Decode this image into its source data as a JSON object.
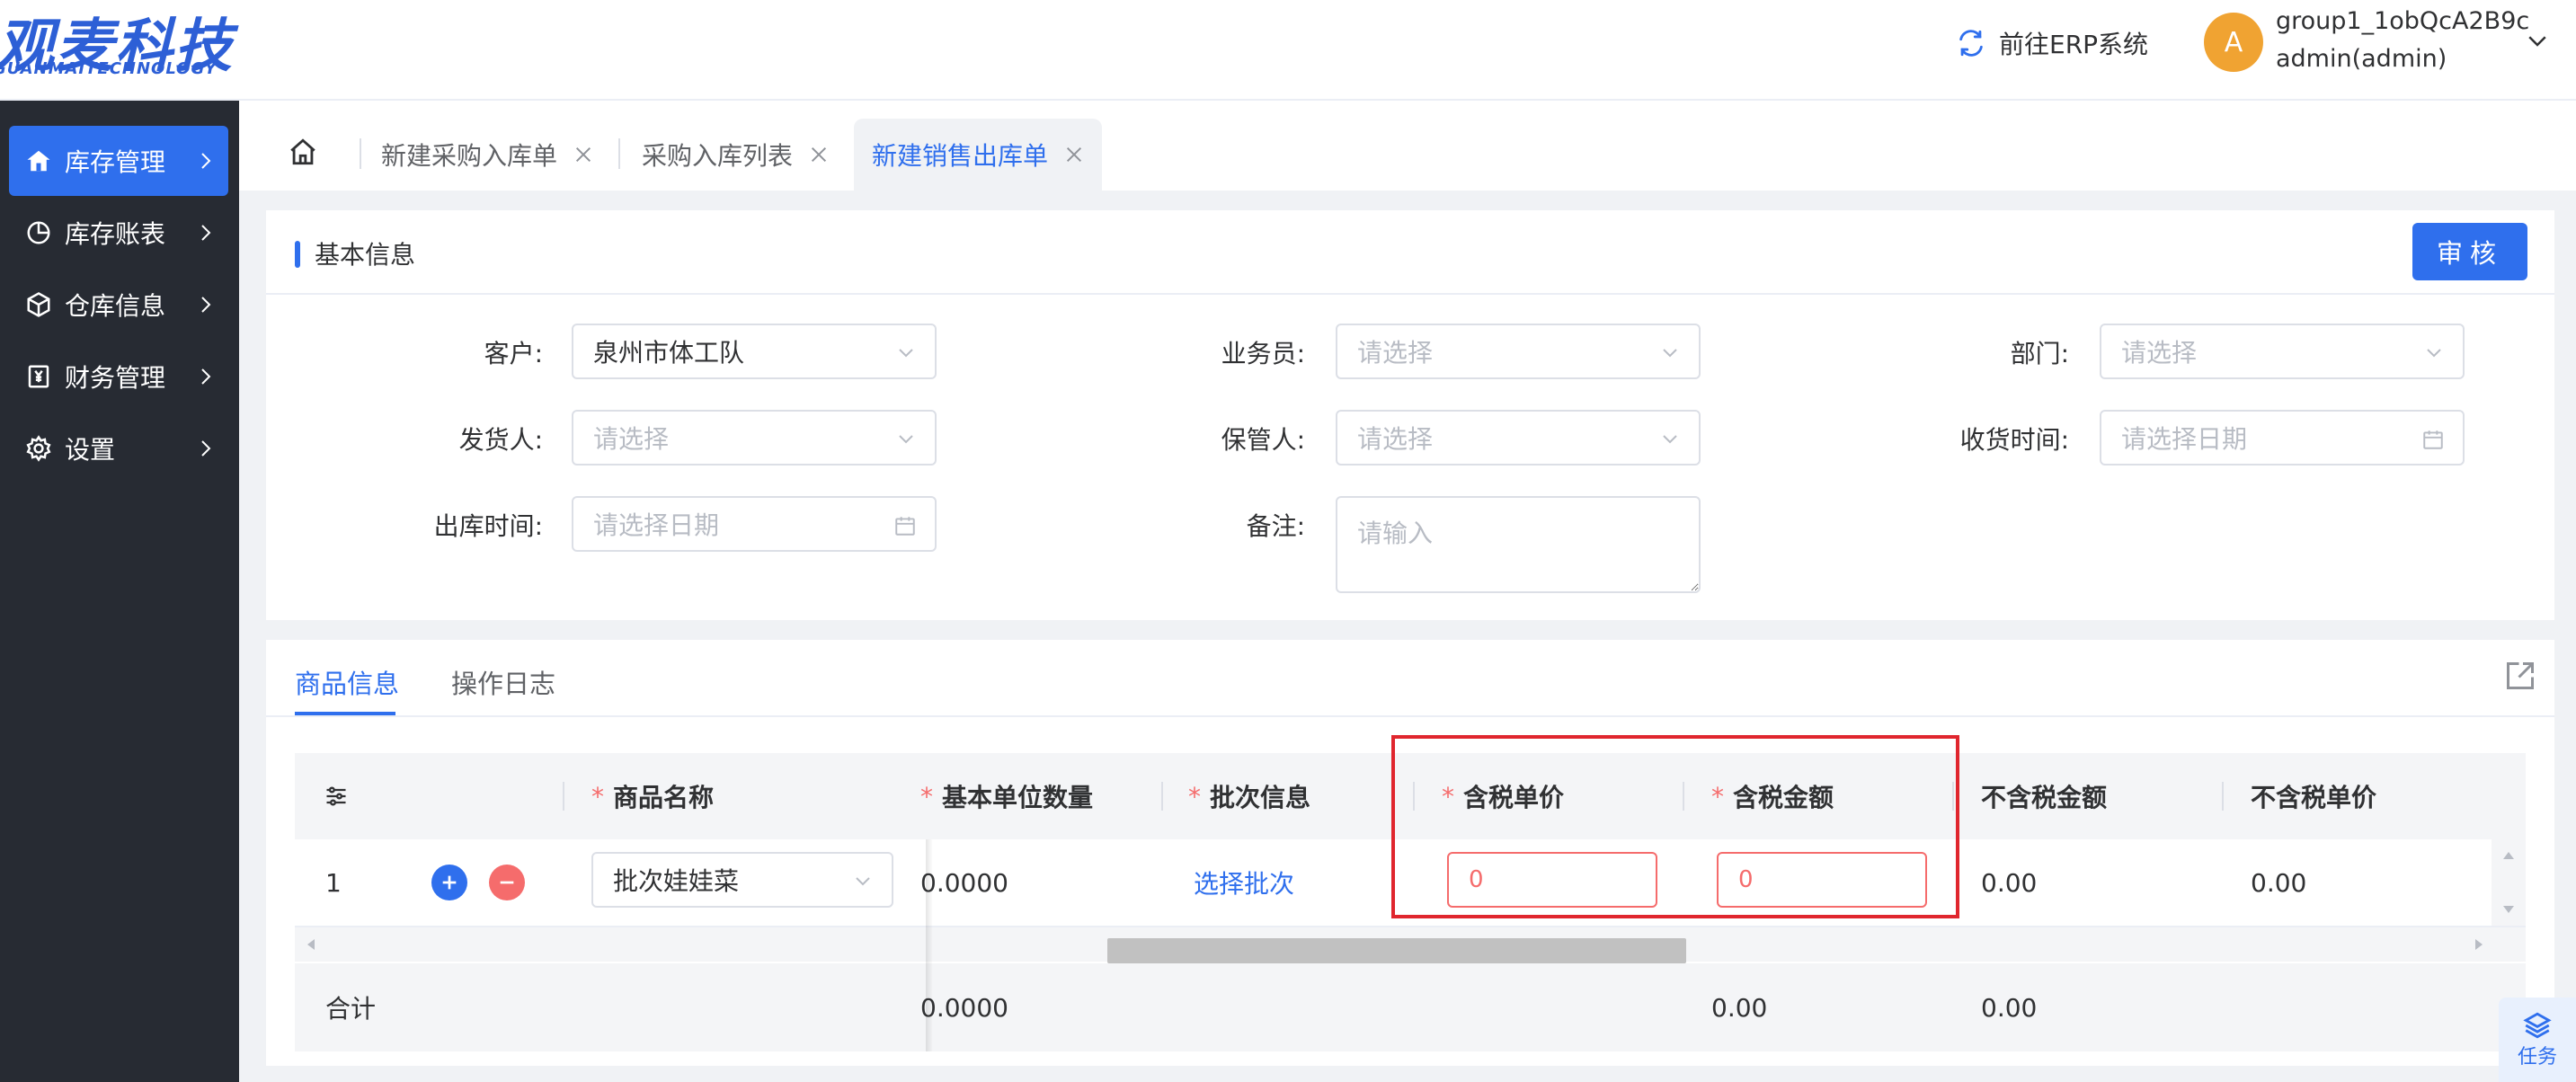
{
  "header": {
    "logo_main": "观麦科技",
    "logo_sub": "GUANMAITECHNOLOGY",
    "erp_link_label": "前往ERP系统",
    "avatar_letter": "A",
    "user_group": "group1_1obQcA2B9c",
    "user_name": "admin(admin)"
  },
  "sidebar": {
    "items": [
      {
        "label": "库存管理",
        "icon": "home-icon",
        "active": true
      },
      {
        "label": "库存账表",
        "icon": "pie-chart-icon",
        "active": false
      },
      {
        "label": "仓库信息",
        "icon": "cube-icon",
        "active": false
      },
      {
        "label": "财务管理",
        "icon": "yen-icon",
        "active": false
      },
      {
        "label": "设置",
        "icon": "gear-icon",
        "active": false
      }
    ]
  },
  "tabs": [
    {
      "label": "新建采购入库单",
      "active": false
    },
    {
      "label": "采购入库列表",
      "active": false
    },
    {
      "label": "新建销售出库单",
      "active": true
    }
  ],
  "basic_info": {
    "title": "基本信息",
    "audit_label": "审核",
    "fields": {
      "customer": {
        "label": "客户:",
        "value": "泉州市体工队"
      },
      "salesman": {
        "label": "业务员:",
        "placeholder": "请选择"
      },
      "department": {
        "label": "部门:",
        "placeholder": "请选择"
      },
      "shipper": {
        "label": "发货人:",
        "placeholder": "请选择"
      },
      "keeper": {
        "label": "保管人:",
        "placeholder": "请选择"
      },
      "receive_time": {
        "label": "收货时间:",
        "placeholder": "请选择日期"
      },
      "outbound_time": {
        "label": "出库时间:",
        "placeholder": "请选择日期"
      },
      "remark": {
        "label": "备注:",
        "placeholder": "请输入"
      }
    }
  },
  "goods": {
    "tabs": [
      "商品信息",
      "操作日志"
    ],
    "active_tab": 0,
    "columns": {
      "name": "商品名称",
      "base_qty": "基本单位数量",
      "batch": "批次信息",
      "tax_price": "含税单价",
      "tax_amount": "含税金额",
      "notax_amount": "不含税金额",
      "notax_price": "不含税单价"
    },
    "rows": [
      {
        "index": "1",
        "name": "批次娃娃菜",
        "base_qty": "0.0000",
        "batch_link": "选择批次",
        "tax_price": "0",
        "tax_amount": "0",
        "notax_amount": "0.00",
        "notax_price": "0.00"
      }
    ],
    "totals": {
      "label": "合计",
      "base_qty": "0.0000",
      "tax_amount": "0.00",
      "notax_amount": "0.00"
    }
  },
  "task_button": {
    "label": "任务"
  },
  "colors": {
    "primary": "#2f6fed",
    "required": "#f56c6c",
    "highlight": "#e0262e",
    "sidebar": "#272b33"
  }
}
